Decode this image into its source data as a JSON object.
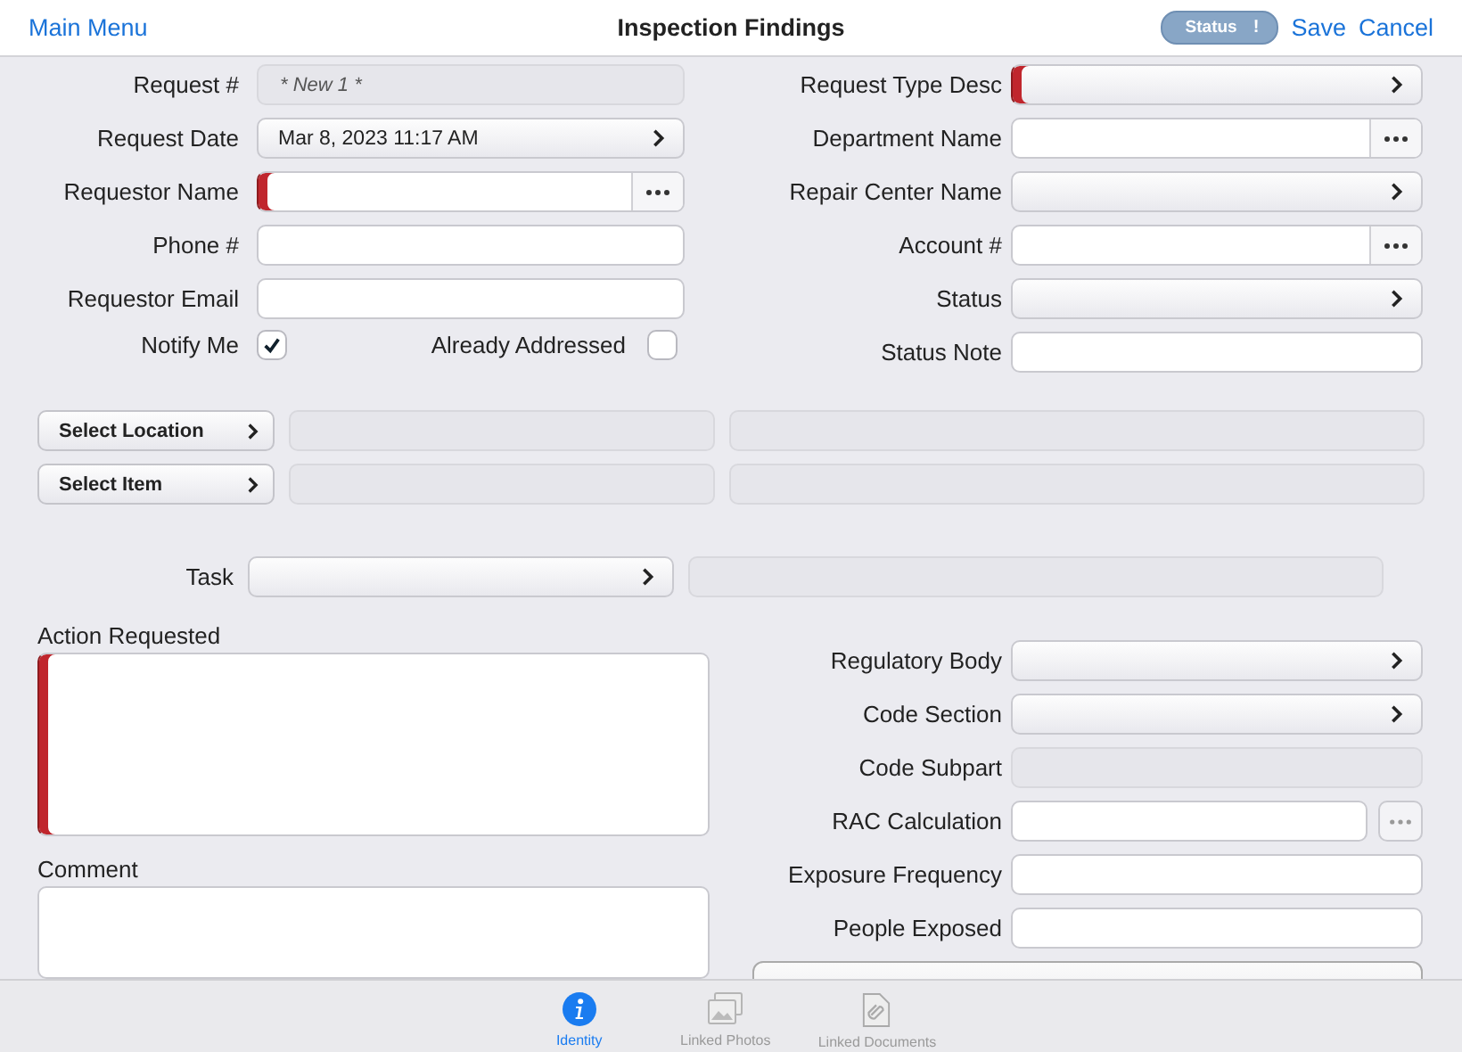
{
  "header": {
    "back": "Main Menu",
    "title": "Inspection Findings",
    "status_badge": {
      "label": "Status",
      "mark": "!"
    },
    "actions": [
      "Save",
      "Cancel"
    ]
  },
  "left_fields": [
    {
      "label": "Request #",
      "kind": "readonly",
      "value": "* New 1 *",
      "required": false
    },
    {
      "label": "Request Date",
      "kind": "picker",
      "value": "Mar 8, 2023 11:17 AM",
      "required": false
    },
    {
      "label": "Requestor Name",
      "kind": "lookup",
      "required": true
    },
    {
      "label": "Phone #",
      "kind": "text",
      "required": false
    },
    {
      "label": "Requestor Email",
      "kind": "text",
      "required": false
    },
    {
      "kind": "checks",
      "items": [
        {
          "label": "Notify Me",
          "checked": true
        },
        {
          "label": "Already Addressed",
          "checked": false
        }
      ]
    }
  ],
  "right_fields": [
    {
      "label": "Request Type Desc",
      "kind": "picker",
      "required": true
    },
    {
      "label": "Department Name",
      "kind": "lookup",
      "required": false
    },
    {
      "label": "Repair Center Name",
      "kind": "picker",
      "required": false
    },
    {
      "label": "Account #",
      "kind": "lookup",
      "required": false
    },
    {
      "label": "Status",
      "kind": "picker",
      "required": false
    },
    {
      "label": "Status Note",
      "kind": "text",
      "required": false
    }
  ],
  "selectors": [
    {
      "button": "Select Location"
    },
    {
      "button": "Select Item"
    }
  ],
  "task": {
    "label": "Task"
  },
  "text_areas": [
    {
      "label": "Action Requested",
      "required": true
    },
    {
      "label": "Comment",
      "required": false
    }
  ],
  "lower_right_fields": [
    {
      "label": "Regulatory Body",
      "kind": "picker",
      "required": false
    },
    {
      "label": "Code Section",
      "kind": "picker",
      "required": false
    },
    {
      "label": "Code Subpart",
      "kind": "readonly",
      "required": false
    },
    {
      "label": "RAC Calculation",
      "kind": "detached",
      "required": false
    },
    {
      "label": "Exposure Frequency",
      "kind": "text",
      "required": false
    },
    {
      "label": "People Exposed",
      "kind": "text",
      "required": false
    }
  ],
  "tabs": [
    {
      "label": "Identity",
      "kind": "info",
      "selected": true
    },
    {
      "label": "Linked Photos",
      "kind": "photos",
      "selected": false
    },
    {
      "label": "Linked Documents",
      "kind": "document",
      "selected": false
    }
  ]
}
